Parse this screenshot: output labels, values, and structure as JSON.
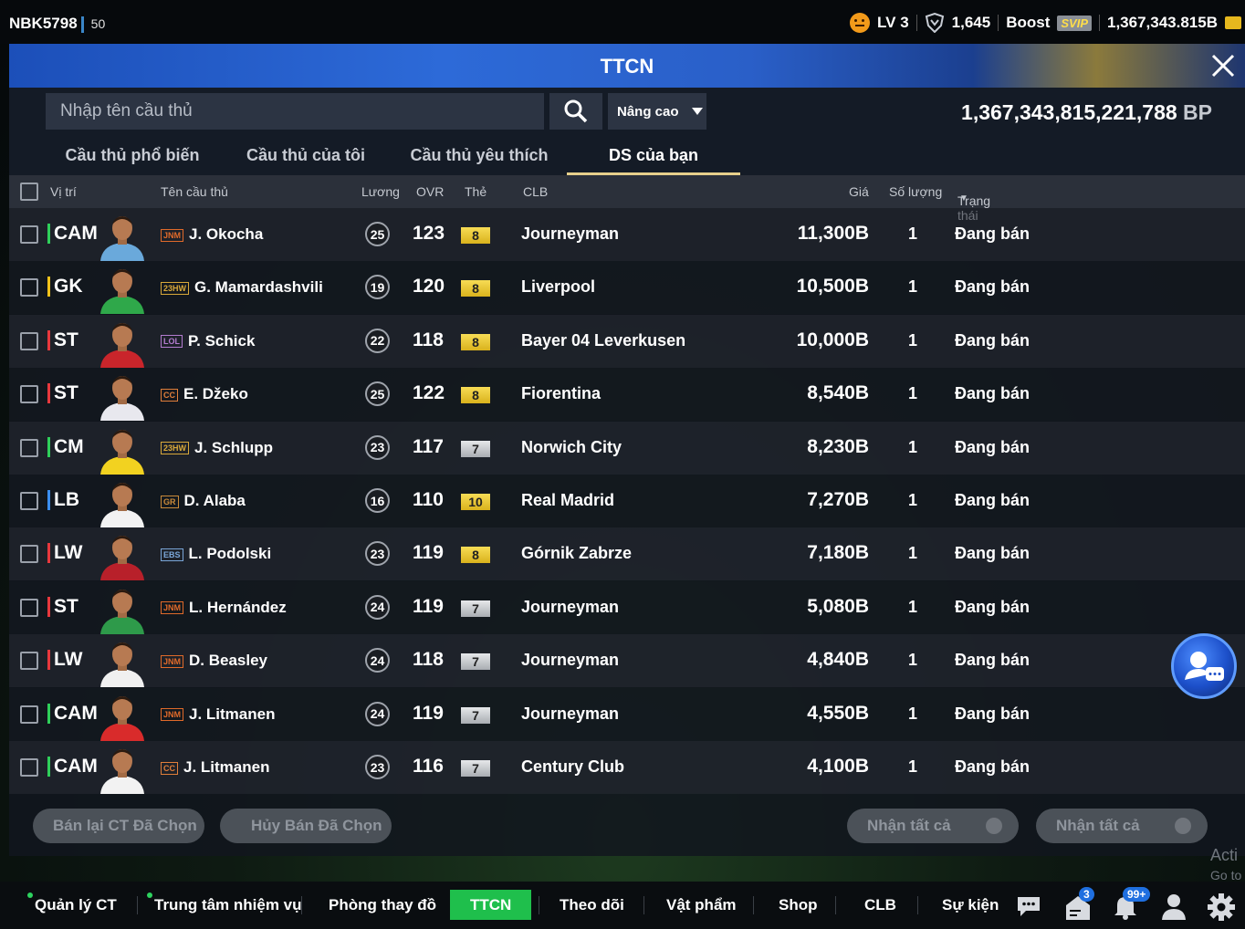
{
  "topbar": {
    "username": "NBK5798",
    "level_badge": "50",
    "lv": "LV 3",
    "trophy": "1,645",
    "boost": "Boost",
    "svip": "SVIP",
    "currency": "1,367,343.815B"
  },
  "window": {
    "title": "TTCN"
  },
  "search": {
    "placeholder": "Nhập tên cầu thủ",
    "advanced_label": "Nâng cao",
    "bp_value": "1,367,343,815,221,788",
    "bp_unit": "BP"
  },
  "tabs": [
    {
      "label": "Cầu thủ phổ biến",
      "active": false
    },
    {
      "label": "Cầu thủ của tôi",
      "active": false
    },
    {
      "label": "Cầu thủ yêu thích",
      "active": false
    },
    {
      "label": "DS của bạn",
      "active": true
    }
  ],
  "columns": {
    "position": "Vị trí",
    "name": "Tên cầu thủ",
    "salary": "Lương",
    "ovr": "OVR",
    "grade": "Thẻ",
    "club": "CLB",
    "price": "Giá",
    "quantity": "Số lượng",
    "status": "Trạng thái"
  },
  "rows": [
    {
      "pos": "CAM",
      "pos_color": "#2fcf5a",
      "season": "JNM",
      "season_color": "#e06a2a",
      "name": "J. Okocha",
      "salary": "25",
      "ovr": "123",
      "grade": "8",
      "grade_type": "gold",
      "club": "Journeyman",
      "price": "11,300B",
      "qty": "1",
      "status": "Đang bán",
      "jersey": "#6aa9db"
    },
    {
      "pos": "GK",
      "pos_color": "#f2c21a",
      "season": "23HW",
      "season_color": "#d8a83a",
      "name": "G. Mamardashvili",
      "salary": "19",
      "ovr": "120",
      "grade": "8",
      "grade_type": "gold",
      "club": "Liverpool",
      "price": "10,500B",
      "qty": "1",
      "status": "Đang bán",
      "jersey": "#2fa84a"
    },
    {
      "pos": "ST",
      "pos_color": "#e8383d",
      "season": "LOL",
      "season_color": "#b47cd0",
      "name": "P. Schick",
      "salary": "22",
      "ovr": "118",
      "grade": "8",
      "grade_type": "gold",
      "club": "Bayer 04 Leverkusen",
      "price": "10,000B",
      "qty": "1",
      "status": "Đang bán",
      "jersey": "#c9252b"
    },
    {
      "pos": "ST",
      "pos_color": "#e8383d",
      "season": "CC",
      "season_color": "#e07e3a",
      "name": "E. Džeko",
      "salary": "25",
      "ovr": "122",
      "grade": "8",
      "grade_type": "gold",
      "club": "Fiorentina",
      "price": "8,540B",
      "qty": "1",
      "status": "Đang bán",
      "jersey": "#e8e8ee"
    },
    {
      "pos": "CM",
      "pos_color": "#2fcf5a",
      "season": "23HW",
      "season_color": "#d8a83a",
      "name": "J. Schlupp",
      "salary": "23",
      "ovr": "117",
      "grade": "7",
      "grade_type": "silver",
      "club": "Norwich City",
      "price": "8,230B",
      "qty": "1",
      "status": "Đang bán",
      "jersey": "#f2d220"
    },
    {
      "pos": "LB",
      "pos_color": "#3b8ef0",
      "season": "GR",
      "season_color": "#c98a3a",
      "name": "D. Alaba",
      "salary": "16",
      "ovr": "110",
      "grade": "10",
      "grade_type": "gold",
      "club": "Real Madrid",
      "price": "7,270B",
      "qty": "1",
      "status": "Đang bán",
      "jersey": "#f2f2f2"
    },
    {
      "pos": "LW",
      "pos_color": "#e8383d",
      "season": "EBS",
      "season_color": "#7aa6d8",
      "name": "L. Podolski",
      "salary": "23",
      "ovr": "119",
      "grade": "8",
      "grade_type": "gold",
      "club": "Górnik Zabrze",
      "price": "7,180B",
      "qty": "1",
      "status": "Đang bán",
      "jersey": "#b8202a"
    },
    {
      "pos": "ST",
      "pos_color": "#e8383d",
      "season": "JNM",
      "season_color": "#e06a2a",
      "name": "L. Hernández",
      "salary": "24",
      "ovr": "119",
      "grade": "7",
      "grade_type": "silver",
      "club": "Journeyman",
      "price": "5,080B",
      "qty": "1",
      "status": "Đang bán",
      "jersey": "#2e9a4a"
    },
    {
      "pos": "LW",
      "pos_color": "#e8383d",
      "season": "JNM",
      "season_color": "#e06a2a",
      "name": "D. Beasley",
      "salary": "24",
      "ovr": "118",
      "grade": "7",
      "grade_type": "silver",
      "club": "Journeyman",
      "price": "4,840B",
      "qty": "1",
      "status": "Đang bán",
      "jersey": "#f0f0f0"
    },
    {
      "pos": "CAM",
      "pos_color": "#2fcf5a",
      "season": "JNM",
      "season_color": "#e06a2a",
      "name": "J. Litmanen",
      "salary": "24",
      "ovr": "119",
      "grade": "7",
      "grade_type": "silver",
      "club": "Journeyman",
      "price": "4,550B",
      "qty": "1",
      "status": "Đang bán",
      "jersey": "#d92b2b"
    },
    {
      "pos": "CAM",
      "pos_color": "#2fcf5a",
      "season": "CC",
      "season_color": "#e07e3a",
      "name": "J. Litmanen",
      "salary": "23",
      "ovr": "116",
      "grade": "7",
      "grade_type": "silver",
      "club": "Century Club",
      "price": "4,100B",
      "qty": "1",
      "status": "Đang bán",
      "jersey": "#f2f2f2"
    }
  ],
  "actions": {
    "resell_selected": "Bán lại CT Đã Chọn",
    "cancel_selected": "Hủy Bán Đã Chọn",
    "claim_all_1": "Nhận tất cả",
    "claim_all_2": "Nhận tất cả"
  },
  "bottom_nav": [
    {
      "label": "Quản lý CT",
      "dot": true
    },
    {
      "label": "Trung tâm nhiệm vụ",
      "dot": true
    },
    {
      "label": "Phòng thay đồ",
      "dot": false
    },
    {
      "label": "TTCN",
      "dot": false,
      "active": true
    },
    {
      "label": "Theo dõi",
      "dot": false
    },
    {
      "label": "Vật phẩm",
      "dot": false
    },
    {
      "label": "Shop",
      "dot": false
    },
    {
      "label": "CLB",
      "dot": false
    },
    {
      "label": "Sự kiện",
      "dot": false
    }
  ],
  "badges": {
    "mail": "3",
    "notifications": "99+"
  },
  "watermark": {
    "line1": "Acti",
    "line2": "Go to"
  },
  "icons": [
    "face-icon",
    "shield-icon",
    "coin-icon",
    "close-icon",
    "search-icon",
    "chevron-down-icon",
    "chat-icon",
    "mail-icon",
    "bell-icon",
    "profile-icon",
    "gear-icon"
  ]
}
